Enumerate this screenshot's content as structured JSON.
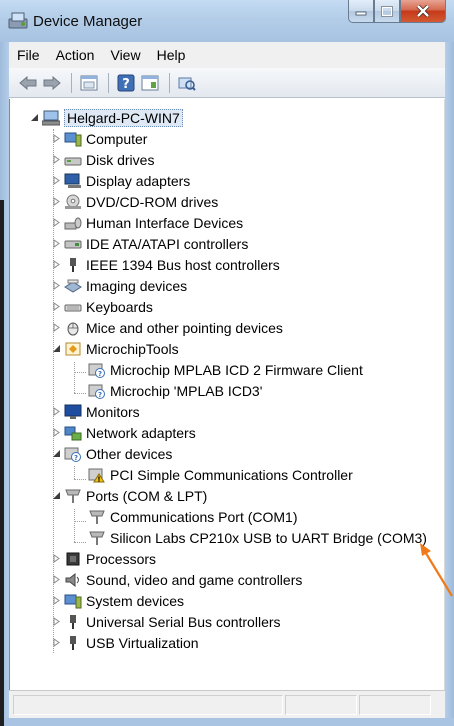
{
  "window": {
    "title": "Device Manager"
  },
  "menu": {
    "items": [
      "File",
      "Action",
      "View",
      "Help"
    ]
  },
  "toolbar": {
    "buttons": [
      "back-icon",
      "forward-icon",
      "properties-icon",
      "help-icon",
      "update-driver-icon",
      "scan-hardware-icon"
    ]
  },
  "tree": {
    "root": "Helgard-PC-WIN7",
    "items": [
      {
        "label": "Computer",
        "icon": "computer-icon"
      },
      {
        "label": "Disk drives",
        "icon": "disk-drive-icon"
      },
      {
        "label": "Display adapters",
        "icon": "display-adapter-icon"
      },
      {
        "label": "DVD/CD-ROM drives",
        "icon": "dvd-drive-icon"
      },
      {
        "label": "Human Interface Devices",
        "icon": "hid-icon"
      },
      {
        "label": "IDE ATA/ATAPI controllers",
        "icon": "ide-controller-icon"
      },
      {
        "label": "IEEE 1394 Bus host controllers",
        "icon": "ieee1394-icon"
      },
      {
        "label": "Imaging devices",
        "icon": "imaging-device-icon"
      },
      {
        "label": "Keyboards",
        "icon": "keyboard-icon"
      },
      {
        "label": "Mice and other pointing devices",
        "icon": "mouse-icon"
      },
      {
        "label": "MicrochipTools",
        "icon": "microchip-tools-icon",
        "expanded": true,
        "children": [
          {
            "label": "Microchip MPLAB ICD 2 Firmware Client",
            "icon": "unknown-device-icon"
          },
          {
            "label": "Microchip 'MPLAB ICD3'",
            "icon": "unknown-device-icon"
          }
        ]
      },
      {
        "label": "Monitors",
        "icon": "monitor-icon"
      },
      {
        "label": "Network adapters",
        "icon": "network-adapter-icon"
      },
      {
        "label": "Other devices",
        "icon": "other-devices-icon",
        "expanded": true,
        "children": [
          {
            "label": "PCI Simple Communications Controller",
            "icon": "warning-device-icon"
          }
        ]
      },
      {
        "label": "Ports (COM & LPT)",
        "icon": "port-icon",
        "expanded": true,
        "children": [
          {
            "label": "Communications Port (COM1)",
            "icon": "port-icon"
          },
          {
            "label": "Silicon Labs CP210x USB to UART Bridge (COM3)",
            "icon": "port-icon"
          }
        ]
      },
      {
        "label": "Processors",
        "icon": "processor-icon"
      },
      {
        "label": "Sound, video and game controllers",
        "icon": "sound-icon"
      },
      {
        "label": "System devices",
        "icon": "system-device-icon"
      },
      {
        "label": "Universal Serial Bus controllers",
        "icon": "usb-icon"
      },
      {
        "label": "USB Virtualization",
        "icon": "usb-icon"
      }
    ]
  },
  "colors": {
    "annotation_arrow": "#f07a1a",
    "selection": "#dfe9f5"
  }
}
